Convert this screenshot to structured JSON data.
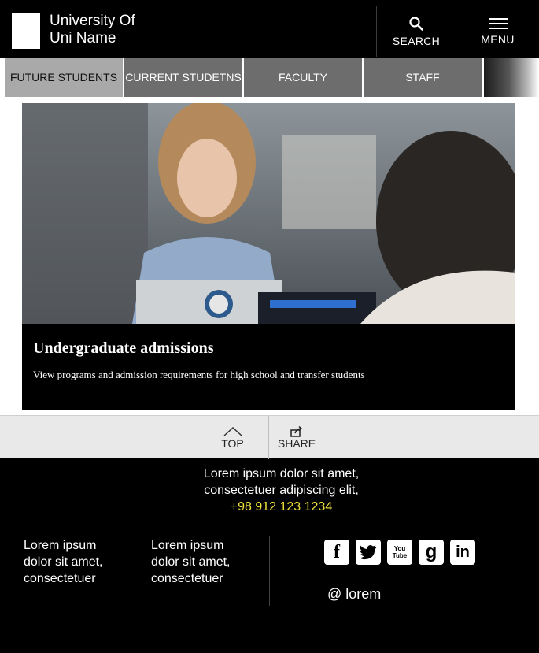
{
  "header": {
    "brand_line1": "University Of",
    "brand_line2": "Uni Name",
    "search_label": "SEARCH",
    "menu_label": "MENU",
    "icons": {
      "search": "search-icon",
      "menu": "hamburger-icon"
    }
  },
  "nav": {
    "tabs": [
      {
        "label": "FUTURE STUDENTS",
        "active": true
      },
      {
        "label": "CURRENT STUDETNS",
        "active": false
      },
      {
        "label": "FACULTY",
        "active": false
      },
      {
        "label": "STAFF",
        "active": false
      }
    ]
  },
  "hero": {
    "title": "Undergraduate admissions",
    "subtitle": "View programs and admission requirements for high school and transfer students"
  },
  "actions": {
    "top_label": "TOP",
    "share_label": "SHARE",
    "icons": {
      "top": "chevron-up-icon",
      "share": "share-icon"
    }
  },
  "footer": {
    "contact_line1": "Lorem ipsum dolor sit amet,",
    "contact_line2": "consectetuer adipiscing elit,",
    "phone": "+98 912 123 1234",
    "col1": [
      "Lorem ipsum",
      "dolor sit amet,",
      "consectetuer"
    ],
    "col2": [
      "Lorem ipsum",
      "dolor sit amet,",
      "consectetuer"
    ],
    "social": [
      {
        "name": "facebook-icon",
        "glyph": "f"
      },
      {
        "name": "twitter-icon",
        "glyph": "t"
      },
      {
        "name": "youtube-icon",
        "glyph": "You Tube"
      },
      {
        "name": "google-icon",
        "glyph": "g"
      },
      {
        "name": "linkedin-icon",
        "glyph": "in"
      }
    ],
    "handle": "@ lorem"
  },
  "colors": {
    "background": "#000000",
    "tab_inactive": "#6d6d6d",
    "tab_active": "#a9a9a9",
    "phone": "#f0e13a",
    "actionbar": "#e9e9e9"
  }
}
